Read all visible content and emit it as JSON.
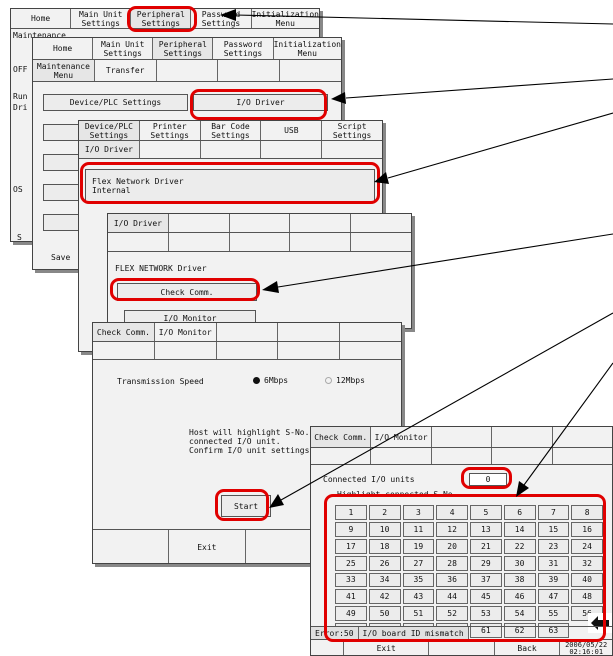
{
  "s1": {
    "tabs": [
      "Home",
      "Main Unit\nSettings",
      "Peripheral\nSettings",
      "Password\nSettings",
      "Initialization\nMenu"
    ],
    "side": [
      "Maintenance",
      "OFF",
      "Run",
      "Dri",
      "OS",
      "S"
    ]
  },
  "s2": {
    "tabs": [
      "Home",
      "Main Unit\nSettings",
      "Peripheral\nSettings",
      "Password\nSettings",
      "Initialization\nMenu"
    ],
    "subtabs": [
      "Maintenance\nMenu",
      "Transfer"
    ],
    "device_plc": "Device/PLC Settings",
    "io_driver": "I/O Driver",
    "save": "Save"
  },
  "s3": {
    "tabs": [
      "Device/PLC\nSettings",
      "Printer\nSettings",
      "Bar Code\nSettings",
      "USB",
      "Script\nSettings"
    ],
    "subtab": "I/O Driver",
    "driver": "Flex Network Driver\nInternal"
  },
  "s4": {
    "tab": "I/O Driver",
    "title": "FLEX NETWORK Driver",
    "check_comm": "Check Comm.",
    "io_monitor": "I/O Monitor"
  },
  "s5": {
    "tabs": [
      "Check Comm.",
      "I/O Monitor"
    ],
    "speed_label": "Transmission Speed",
    "opt1": "6Mbps",
    "opt2": "12Mbps",
    "message": "Host will highlight S-No. of\nconnected I/O unit.\nConfirm I/O unit settings.",
    "start": "Start",
    "exit": "Exit",
    "back_partial": "Ba"
  },
  "s6": {
    "tabs": [
      "Check Comm.",
      "I/O Monitor"
    ],
    "connected_label": "Connected I/O units",
    "connected_value": "0",
    "highlight_label": "Highlight connected S-No.",
    "grid": [
      "1",
      "2",
      "3",
      "4",
      "5",
      "6",
      "7",
      "8",
      "9",
      "10",
      "11",
      "12",
      "13",
      "14",
      "15",
      "16",
      "17",
      "18",
      "19",
      "20",
      "21",
      "22",
      "23",
      "24",
      "25",
      "26",
      "27",
      "28",
      "29",
      "30",
      "31",
      "32",
      "33",
      "34",
      "35",
      "36",
      "37",
      "38",
      "39",
      "40",
      "41",
      "42",
      "43",
      "44",
      "45",
      "46",
      "47",
      "48",
      "49",
      "50",
      "51",
      "52",
      "53",
      "54",
      "55",
      "56",
      "57",
      "58",
      "59",
      "60",
      "61",
      "62",
      "63",
      ""
    ],
    "error_code": "Error:50",
    "error_msg": "I/O board ID mismatch",
    "exit": "Exit",
    "back": "Back",
    "date": "2006/05/22",
    "time": "02:16:01"
  }
}
